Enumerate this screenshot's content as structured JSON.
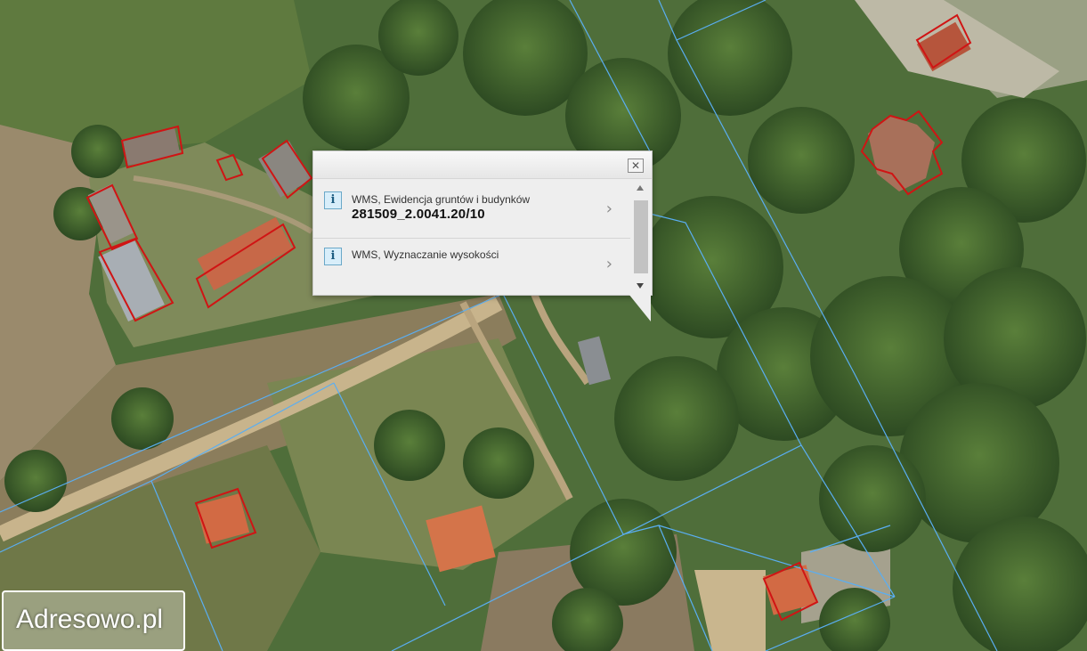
{
  "popup": {
    "close_glyph": "✕",
    "results": [
      {
        "icon": "info-icon",
        "icon_glyph": "i",
        "source": "WMS, Ewidencja gruntów i budynków",
        "value": "281509_2.0041.20/10",
        "chevron": "›"
      },
      {
        "icon": "info-icon",
        "icon_glyph": "i",
        "source": "WMS, Wyznaczanie wysokości",
        "chevron": "›"
      }
    ]
  },
  "watermark": {
    "text": "Adresowo.pl"
  },
  "colors": {
    "parcel_lines": "#5aaef2",
    "building_outlines": "#d01414",
    "popup_bg": "#eeeeee",
    "popup_header": "#eaeaea"
  }
}
